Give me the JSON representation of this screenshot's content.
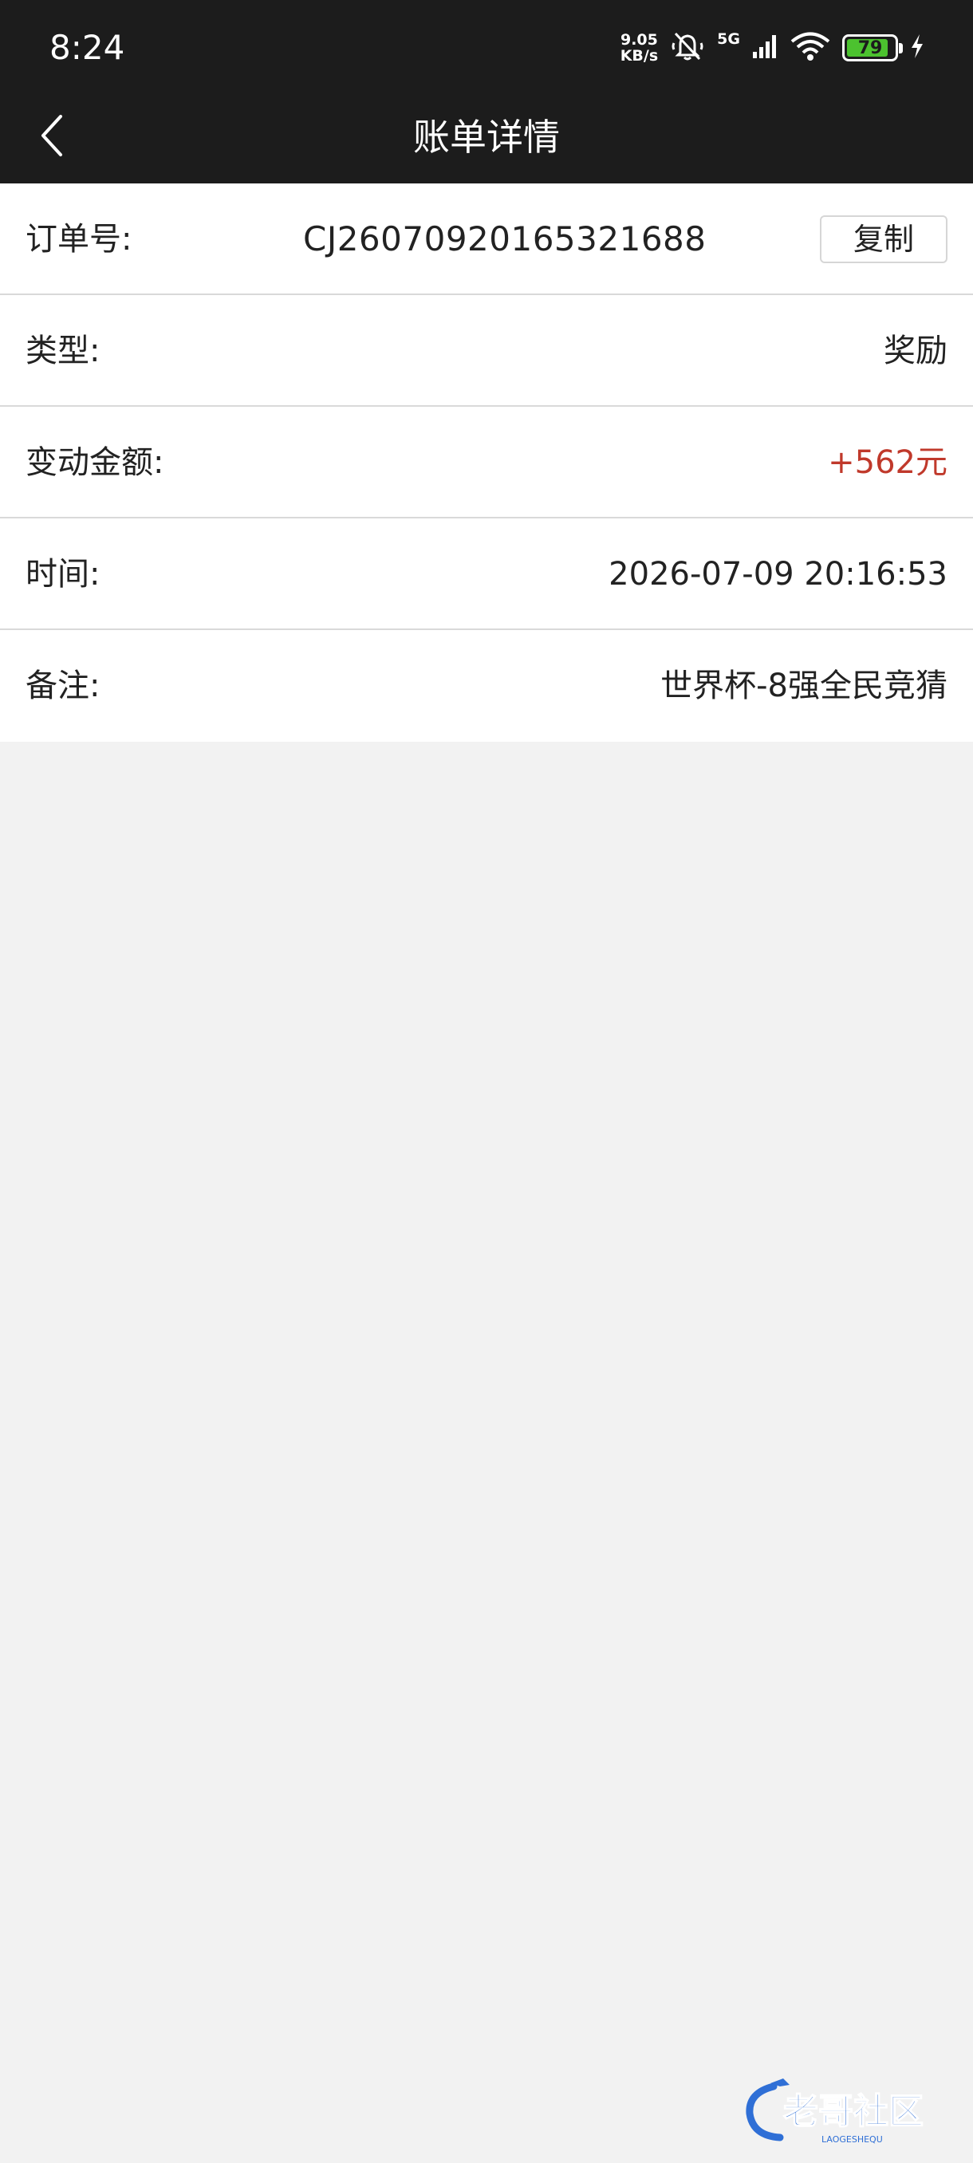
{
  "status_bar": {
    "time": "8:24",
    "speed_value": "9.05",
    "speed_unit": "KB/s",
    "network_type": "5G",
    "battery_level": "79",
    "icons": [
      "mute-icon",
      "signal-icon",
      "wifi-icon",
      "battery-icon",
      "charging-icon"
    ]
  },
  "header": {
    "title": "账单详情",
    "back_icon": "chevron-left-icon"
  },
  "details": {
    "order_label": "订单号:",
    "order_value": "CJ26070920165321688",
    "copy_label": "复制",
    "type_label": "类型:",
    "type_value": "奖励",
    "amount_label": "变动金额:",
    "amount_value": "+562元",
    "time_label": "时间:",
    "time_value": "2026-07-09 20:16:53",
    "note_label": "备注:",
    "note_value": "世界杯-8强全民竞猜"
  },
  "watermark": {
    "text": "老哥社区",
    "subtext": "LAOGESHEQU"
  },
  "colors": {
    "bar_background": "#1c1c1c",
    "page_background": "#f2f2f2",
    "amount_color": "#c0392b",
    "battery_fill": "#4cc22f",
    "watermark_color": "#2f6fd6"
  }
}
